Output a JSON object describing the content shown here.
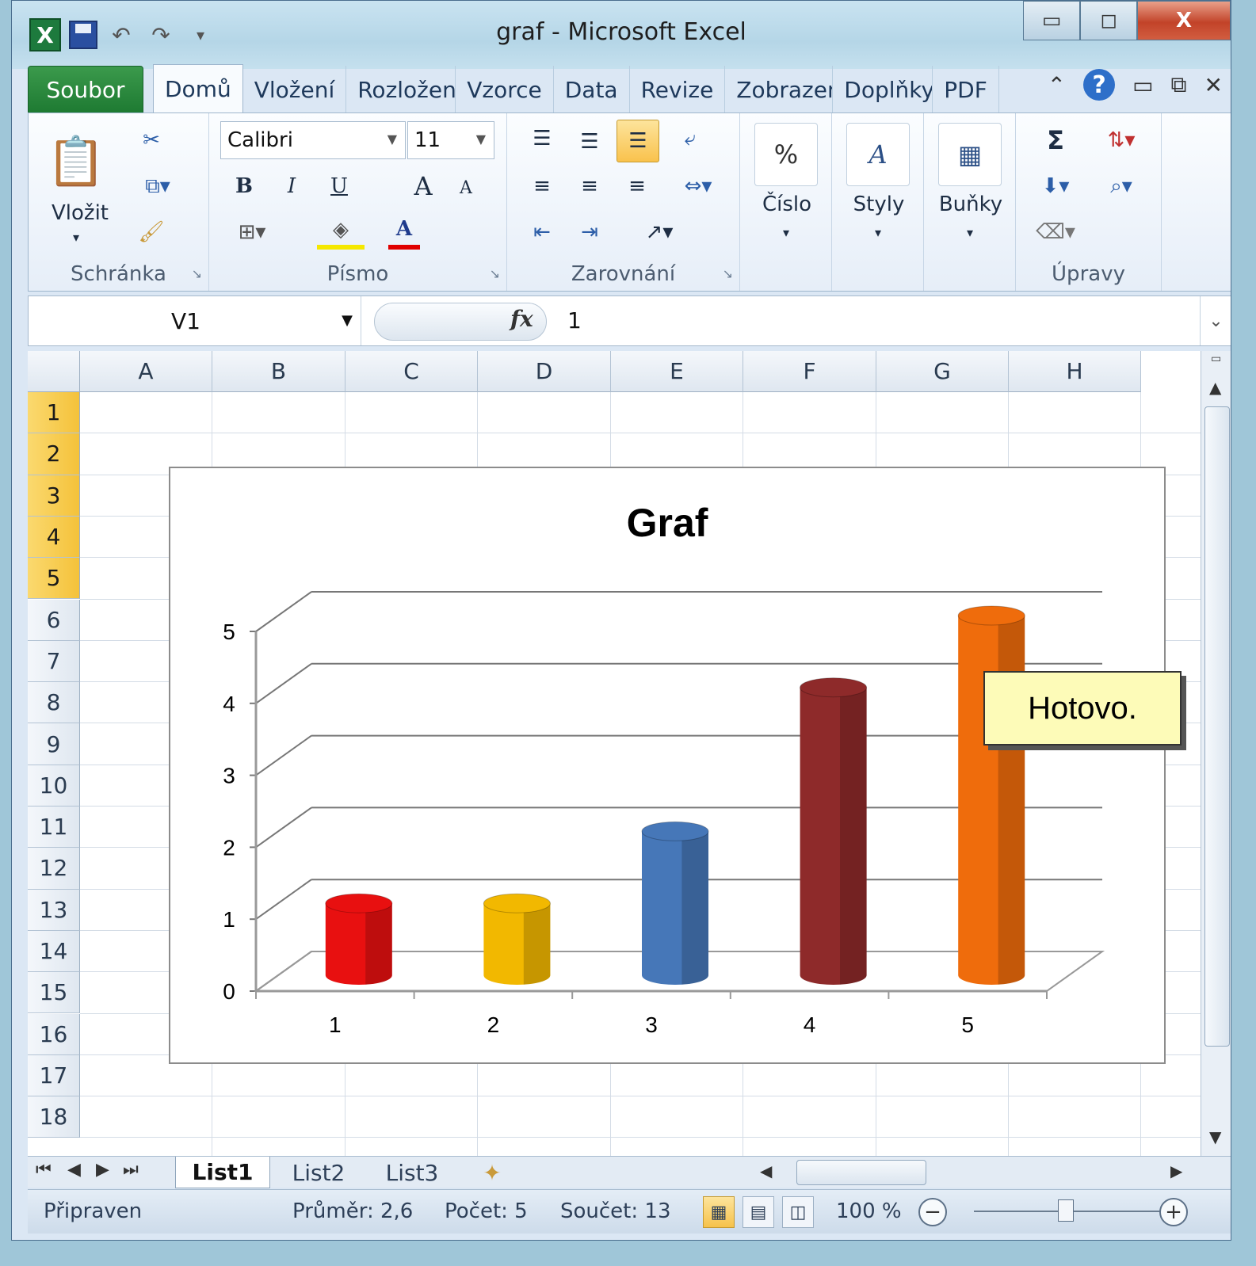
{
  "window": {
    "title": "graf  -  Microsoft Excel",
    "minimize": "▭",
    "restore": "◻",
    "close": "X"
  },
  "qat": {
    "excel_icon": "X",
    "undo": "↶",
    "redo": "↷"
  },
  "tabs": [
    {
      "label": "Soubor"
    },
    {
      "label": "Domů"
    },
    {
      "label": "Vložení"
    },
    {
      "label": "Rozložení"
    },
    {
      "label": "Vzorce"
    },
    {
      "label": "Data"
    },
    {
      "label": "Revize"
    },
    {
      "label": "Zobrazení"
    },
    {
      "label": "Doplňky"
    },
    {
      "label": "PDF"
    }
  ],
  "ribbon": {
    "clipboard": {
      "label": "Schránka",
      "paste": "Vložit"
    },
    "font": {
      "label": "Písmo",
      "font_name": "Calibri",
      "font_size": "11",
      "bold": "B",
      "italic": "I",
      "underline": "U",
      "grow": "A",
      "shrink": "A",
      "color_a": "A"
    },
    "alignment": {
      "label": "Zarovnání"
    },
    "number": {
      "label": "Číslo",
      "percent": "%"
    },
    "styles": {
      "label": "Styly"
    },
    "cells": {
      "label": "Buňky"
    },
    "editing": {
      "label": "Úpravy",
      "sum": "Σ"
    }
  },
  "formula_bar": {
    "name_box": "V1",
    "fx": "fx",
    "value": "1"
  },
  "columns": [
    "A",
    "B",
    "C",
    "D",
    "E",
    "F",
    "G",
    "H"
  ],
  "rows": [
    "1",
    "2",
    "3",
    "4",
    "5",
    "6",
    "7",
    "8",
    "9",
    "10",
    "11",
    "12",
    "13",
    "14",
    "15",
    "16",
    "17",
    "18"
  ],
  "selected_rows": [
    1,
    2,
    3,
    4,
    5
  ],
  "chart_data": {
    "type": "bar",
    "title": "Graf",
    "categories": [
      "1",
      "2",
      "3",
      "4",
      "5"
    ],
    "values": [
      1,
      1,
      2,
      4,
      5
    ],
    "colors": [
      "#e81010",
      "#f2b800",
      "#4677b8",
      "#8e2a2a",
      "#ef6c0c"
    ],
    "ylim": [
      0,
      5
    ],
    "yticks": [
      "0",
      "1",
      "2",
      "3",
      "4",
      "5"
    ],
    "grid": true,
    "style": "3d-cylinder"
  },
  "tooltip": {
    "text": "Hotovo."
  },
  "sheets": [
    "List1",
    "List2",
    "List3"
  ],
  "status": {
    "ready": "Připraven",
    "average": "Průměr: 2,6",
    "count": "Počet: 5",
    "sum": "Součet: 13",
    "zoom": "100 %"
  }
}
